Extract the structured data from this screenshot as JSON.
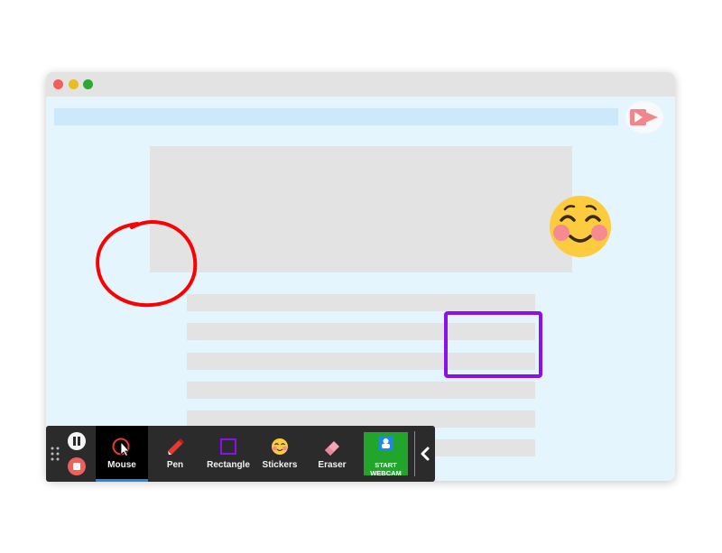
{
  "window": {
    "traffic_lights": [
      "#f0605a",
      "#e7bd1f",
      "#2ea82e"
    ],
    "background_color": "#e4f5fd",
    "logo_icon": "camera-arrow-logo"
  },
  "annotations": {
    "circle_color": "#ff0000",
    "rectangle_color": "#8b10ee",
    "sticker": "blushing-smile-emoji"
  },
  "toolbar": {
    "controls": {
      "pause_icon": "pause-icon",
      "stop_icon": "stop-icon",
      "stop_color": "#f0605a"
    },
    "tools": [
      {
        "label": "Mouse",
        "icon": "mouse-cursor-icon",
        "active": true
      },
      {
        "label": "Pen",
        "icon": "pen-icon",
        "active": false
      },
      {
        "label": "Rectangle",
        "icon": "rectangle-icon",
        "active": false
      },
      {
        "label": "Stickers",
        "icon": "sticker-icon",
        "active": false
      },
      {
        "label": "Eraser",
        "icon": "eraser-icon",
        "active": false
      }
    ],
    "webcam": {
      "line1": "START",
      "line2": "WEBCAM",
      "color": "#22a52b"
    },
    "accent_color": "#1e88e5"
  }
}
